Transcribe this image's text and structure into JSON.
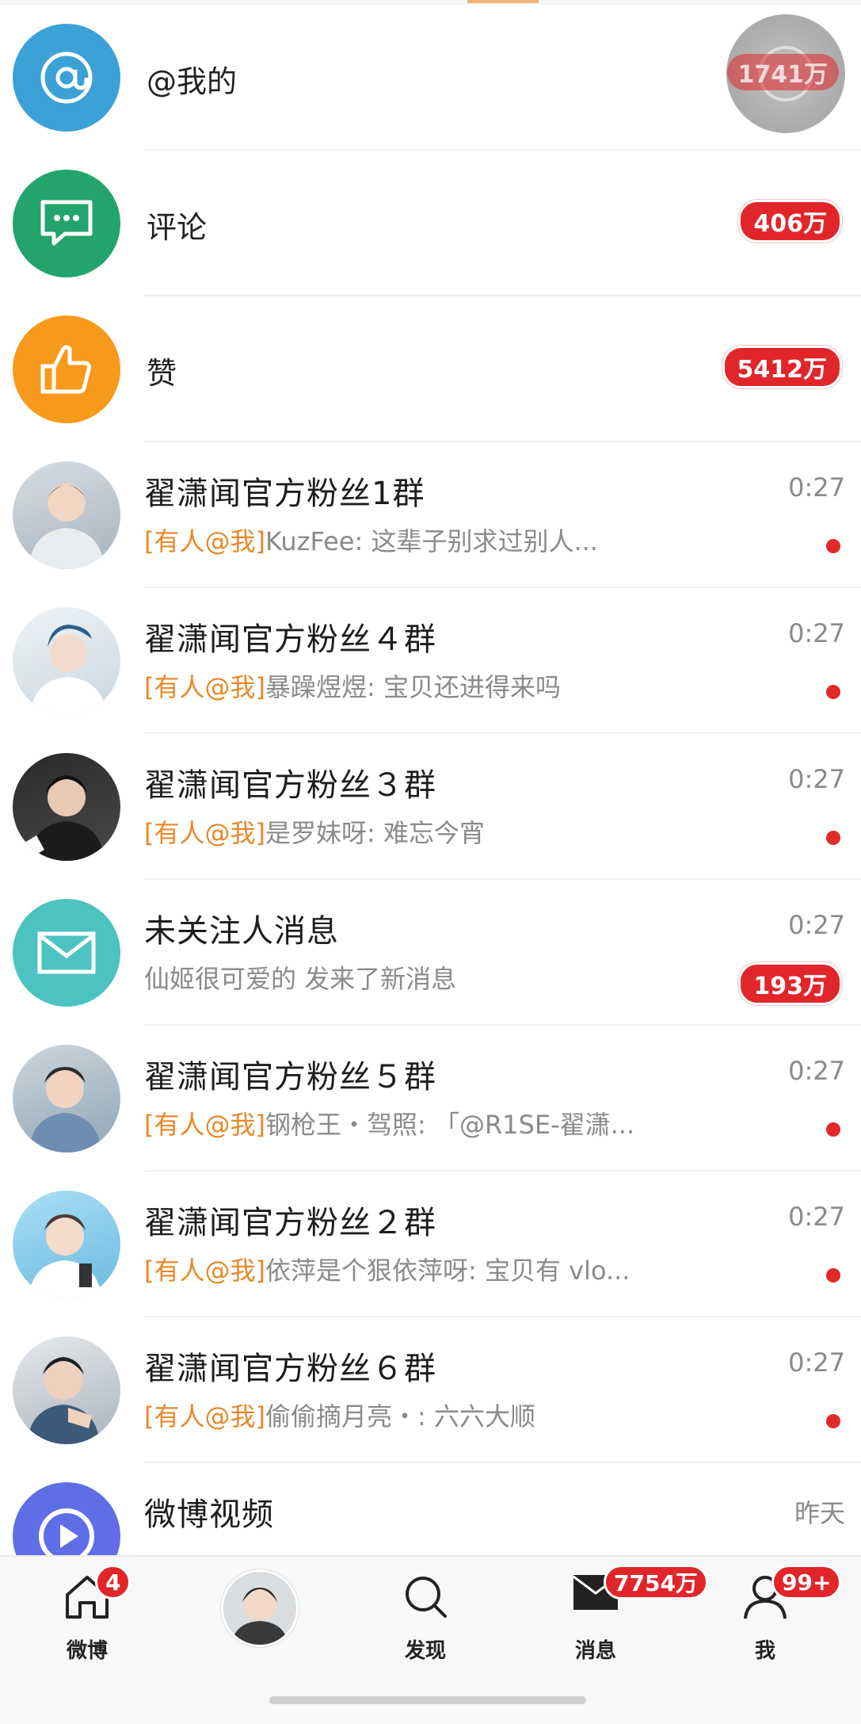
{
  "top_items": [
    {
      "label": "@我的",
      "badge": "1741万",
      "icon": "at-icon",
      "color": "#3ba1d6"
    },
    {
      "label": "评论",
      "badge": "406万",
      "icon": "comment-icon",
      "color": "#22a46a"
    },
    {
      "label": "赞",
      "badge": "5412万",
      "icon": "thumbs-up-icon",
      "color": "#f79a1b"
    }
  ],
  "conversations": [
    {
      "title": "翟潇闻官方粉丝1群",
      "time": "0:27",
      "tag": "[有人@我]",
      "preview": "KuzFee: 这辈子别求过别人...",
      "unread_dot": true
    },
    {
      "title": "翟潇闻官方粉丝４群",
      "time": "0:27",
      "tag": "[有人@我]",
      "preview": "暴躁煜煜: 宝贝还进得来吗",
      "unread_dot": true
    },
    {
      "title": "翟潇闻官方粉丝３群",
      "time": "0:27",
      "tag": "[有人@我]",
      "preview": "是罗妹呀: 难忘今宵",
      "unread_dot": true
    },
    {
      "title": "未关注人消息",
      "time": "0:27",
      "tag": "",
      "preview": "仙姬很可爱的 发来了新消息",
      "badge": "193万",
      "icon": "envelope-icon",
      "color": "#4cc3c0"
    },
    {
      "title": "翟潇闻官方粉丝５群",
      "time": "0:27",
      "tag": "[有人@我]",
      "preview": "钢枪王・驾照: 「@R1SE-翟潇...",
      "unread_dot": true
    },
    {
      "title": "翟潇闻官方粉丝２群",
      "time": "0:27",
      "tag": "[有人@我]",
      "preview": "依萍是个狠依萍呀: 宝贝有 vlo...",
      "unread_dot": true
    },
    {
      "title": "翟潇闻官方粉丝６群",
      "time": "0:27",
      "tag": "[有人@我]",
      "preview": "偷偷摘月亮・: 六六大顺",
      "unread_dot": true
    },
    {
      "title": "微博视频",
      "time": "昨天",
      "icon": "video-play-icon",
      "color": "#5f6ee6"
    }
  ],
  "tabbar": {
    "home": {
      "label": "微博",
      "badge": "4"
    },
    "discover": {
      "label": "发现"
    },
    "messages": {
      "label": "消息",
      "badge": "7754万"
    },
    "me": {
      "label": "我",
      "badge": "99+"
    }
  }
}
